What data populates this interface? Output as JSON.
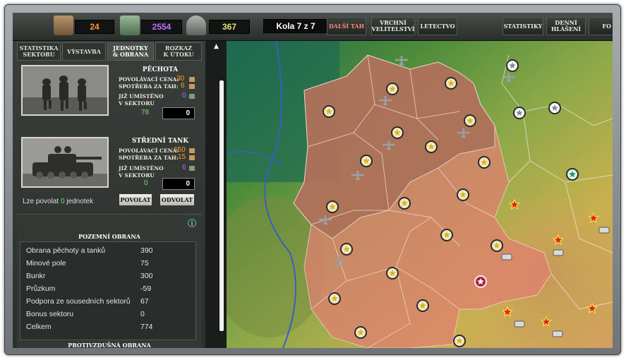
{
  "resources": {
    "supplies": "24",
    "fuel": "2554",
    "manpower": "367"
  },
  "turn": "Kola 7 z 7",
  "toolbar": {
    "next_turn": "DALŠÍ TAH",
    "high_command_1": "VRCHNÍ",
    "high_command_2": "VELITELSTVÍ",
    "air_force": "LETECTVO",
    "statistics": "STATISTIKY",
    "daily_1": "DENNÍ",
    "daily_2": "HLÁŠENÍ",
    "cut": "FO"
  },
  "tabs": [
    {
      "l1": "STATISTIKA",
      "l2": "SEKTORU"
    },
    {
      "l1": "VÝSTAVBA",
      "l2": ""
    },
    {
      "l1": "JEDNOTKY",
      "l2": "& OBRANA"
    },
    {
      "l1": "ROZKAZ",
      "l2": "K ÚTOKU"
    }
  ],
  "units": [
    {
      "name": "PĚCHOTA",
      "cost_label": "POVOLÁVACÍ CENA:",
      "cost": "30",
      "upkeep_label": "SPOTŘEBA ZA TAH:",
      "upkeep": "6",
      "deployed_label": "JIŽ UMÍSTĚNO",
      "deployed": "0",
      "sector_label": "V SEKTORU",
      "in_sector": "78",
      "qty": "0"
    },
    {
      "name": "STŘEDNÍ TANK",
      "cost_label": "POVOLÁVACÍ CENA:",
      "cost": "650",
      "upkeep_label": "SPOTŘEBA ZA TAH:",
      "upkeep": "15",
      "deployed_label": "JIŽ UMÍSTĚNO",
      "deployed": "6",
      "sector_label": "V SEKTORU",
      "in_sector": "0",
      "qty": "0"
    }
  ],
  "deploy": {
    "prefix": "Lze povolat",
    "count": "0",
    "suffix": "jednotek"
  },
  "buttons": {
    "recruit": "POVOLAT",
    "dismiss": "ODVOLAT"
  },
  "ground_defense": {
    "title": "POZEMNÍ OBRANA",
    "rows": [
      {
        "label": "Obrana pěchoty a tanků",
        "value": "390"
      },
      {
        "label": "Minové pole",
        "value": "75"
      },
      {
        "label": "Bunkr",
        "value": "300"
      },
      {
        "label": "Průzkum",
        "value": "-59"
      },
      {
        "label": "Podpora ze sousedních sektorů",
        "value": "67"
      },
      {
        "label": "Bonus sektoru",
        "value": "0"
      },
      {
        "label": "Celkem",
        "value": "774"
      }
    ]
  },
  "air_defense": {
    "title": "PROTIVZDUŠNÁ OBRANA"
  },
  "colors": {
    "supplies": "#ff9a30",
    "fuel": "#c070ff",
    "manpower": "#e8e070",
    "green": "#6ee06e",
    "orange": "#ff9a30",
    "purple": "#b070ff",
    "own_territory": "#b86b55",
    "enemy_territory": "#e08070"
  }
}
